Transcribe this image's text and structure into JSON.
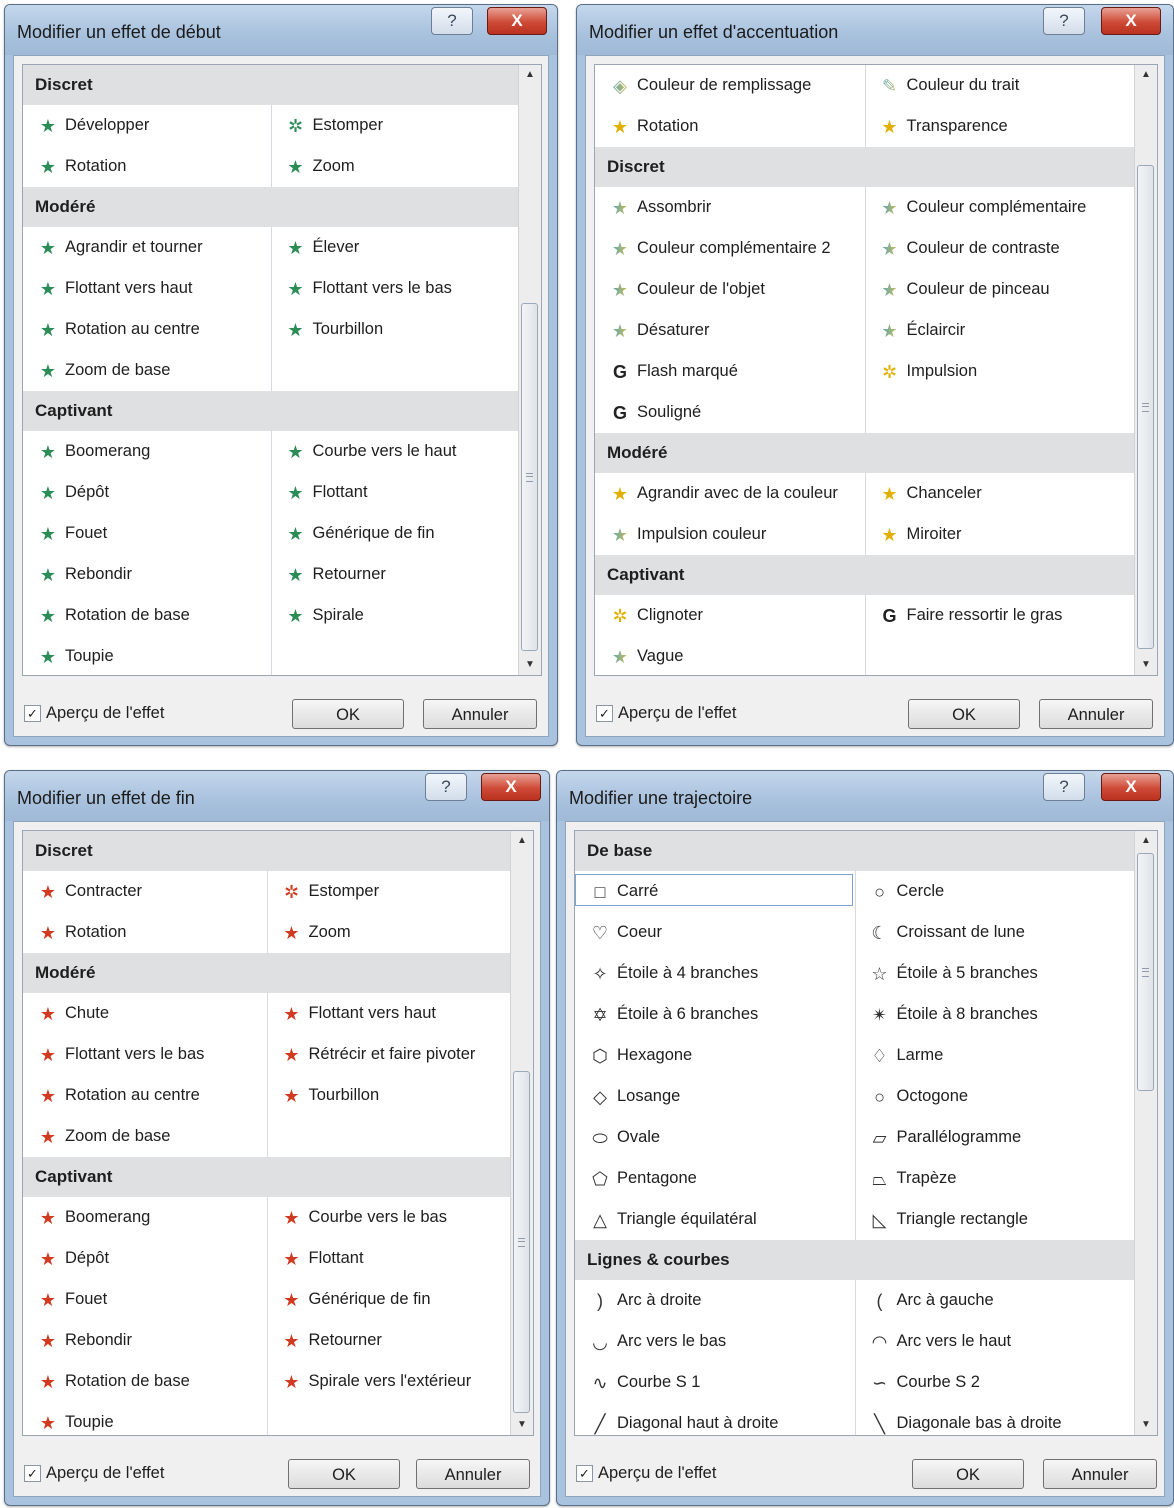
{
  "dialogs": [
    {
      "title": "Modifier un effet de début",
      "help_glyph": "?",
      "close_glyph": "X",
      "preview_label": "Aperçu de l'effet",
      "preview_checked": true,
      "check_glyph": "✓",
      "ok_label": "OK",
      "cancel_label": "Annuler",
      "scroll_up_glyph": "▲",
      "scroll_down_glyph": "▼",
      "sections": [
        {
          "title": "Discret",
          "items": [
            {
              "label": "Développer",
              "icon": "★",
              "color": "g"
            },
            {
              "label": "Estomper",
              "icon": "✲",
              "color": "g"
            },
            {
              "label": "Rotation",
              "icon": "★",
              "color": "g"
            },
            {
              "label": "Zoom",
              "icon": "★",
              "color": "g"
            }
          ]
        },
        {
          "title": "Modéré",
          "items": [
            {
              "label": "Agrandir et tourner",
              "icon": "★",
              "color": "g"
            },
            {
              "label": "Élever",
              "icon": "★",
              "color": "g"
            },
            {
              "label": "Flottant vers haut",
              "icon": "★",
              "color": "g"
            },
            {
              "label": "Flottant vers le bas",
              "icon": "★",
              "color": "g"
            },
            {
              "label": "Rotation au centre",
              "icon": "★",
              "color": "g"
            },
            {
              "label": "Tourbillon",
              "icon": "★",
              "color": "g"
            },
            {
              "label": "Zoom de base",
              "icon": "★",
              "color": "g"
            }
          ]
        },
        {
          "title": "Captivant",
          "items": [
            {
              "label": "Boomerang",
              "icon": "★",
              "color": "g"
            },
            {
              "label": "Courbe vers le haut",
              "icon": "★",
              "color": "g"
            },
            {
              "label": "Dépôt",
              "icon": "★",
              "color": "g"
            },
            {
              "label": "Flottant",
              "icon": "★",
              "color": "g"
            },
            {
              "label": "Fouet",
              "icon": "★",
              "color": "g"
            },
            {
              "label": "Générique de fin",
              "icon": "★",
              "color": "g"
            },
            {
              "label": "Rebondir",
              "icon": "★",
              "color": "g"
            },
            {
              "label": "Retourner",
              "icon": "★",
              "color": "g"
            },
            {
              "label": "Rotation de base",
              "icon": "★",
              "color": "g"
            },
            {
              "label": "Spirale",
              "icon": "★",
              "color": "g"
            },
            {
              "label": "Toupie",
              "icon": "★",
              "color": "g"
            }
          ]
        }
      ]
    },
    {
      "title": "Modifier un effet d'accentuation",
      "help_glyph": "?",
      "close_glyph": "X",
      "preview_label": "Aperçu de l'effet",
      "preview_checked": true,
      "check_glyph": "✓",
      "ok_label": "OK",
      "cancel_label": "Annuler",
      "scroll_up_glyph": "▲",
      "scroll_down_glyph": "▼",
      "sections": [
        {
          "title": "",
          "items": [
            {
              "label": "Couleur de remplissage",
              "icon": "◈",
              "color": "mix"
            },
            {
              "label": "Couleur du trait",
              "icon": "✎",
              "color": "mix"
            },
            {
              "label": "Rotation",
              "icon": "★",
              "color": "y"
            },
            {
              "label": "Transparence",
              "icon": "★",
              "color": "y"
            }
          ]
        },
        {
          "title": "Discret",
          "items": [
            {
              "label": "Assombrir",
              "icon": "★",
              "color": "mix"
            },
            {
              "label": "Couleur complémentaire",
              "icon": "★",
              "color": "mix"
            },
            {
              "label": "Couleur complémentaire 2",
              "icon": "★",
              "color": "mix"
            },
            {
              "label": "Couleur de contraste",
              "icon": "★",
              "color": "mix"
            },
            {
              "label": "Couleur de l'objet",
              "icon": "★",
              "color": "mix"
            },
            {
              "label": "Couleur de pinceau",
              "icon": "★",
              "color": "mix"
            },
            {
              "label": "Désaturer",
              "icon": "★",
              "color": "mix"
            },
            {
              "label": "Éclaircir",
              "icon": "★",
              "color": "mix"
            },
            {
              "label": "Flash marqué",
              "icon": "G",
              "color": "b"
            },
            {
              "label": "Impulsion",
              "icon": "✲",
              "color": "y"
            },
            {
              "label": "Souligné",
              "icon": "G",
              "color": "b"
            }
          ]
        },
        {
          "title": "Modéré",
          "items": [
            {
              "label": "Agrandir avec de la couleur",
              "icon": "★",
              "color": "y"
            },
            {
              "label": "Chanceler",
              "icon": "★",
              "color": "y"
            },
            {
              "label": "Impulsion couleur",
              "icon": "★",
              "color": "mix"
            },
            {
              "label": "Miroiter",
              "icon": "★",
              "color": "y"
            }
          ]
        },
        {
          "title": "Captivant",
          "items": [
            {
              "label": "Clignoter",
              "icon": "✲",
              "color": "y"
            },
            {
              "label": "Faire ressortir le gras",
              "icon": "G",
              "color": "b"
            },
            {
              "label": "Vague",
              "icon": "★",
              "color": "mix"
            }
          ]
        }
      ]
    },
    {
      "title": "Modifier un effet de fin",
      "help_glyph": "?",
      "close_glyph": "X",
      "preview_label": "Aperçu de l'effet",
      "preview_checked": true,
      "check_glyph": "✓",
      "ok_label": "OK",
      "cancel_label": "Annuler",
      "scroll_up_glyph": "▲",
      "scroll_down_glyph": "▼",
      "sections": [
        {
          "title": "Discret",
          "items": [
            {
              "label": "Contracter",
              "icon": "★",
              "color": "r"
            },
            {
              "label": "Estomper",
              "icon": "✲",
              "color": "r"
            },
            {
              "label": "Rotation",
              "icon": "★",
              "color": "r"
            },
            {
              "label": "Zoom",
              "icon": "★",
              "color": "r"
            }
          ]
        },
        {
          "title": "Modéré",
          "items": [
            {
              "label": "Chute",
              "icon": "★",
              "color": "r"
            },
            {
              "label": "Flottant vers haut",
              "icon": "★",
              "color": "r"
            },
            {
              "label": "Flottant vers le bas",
              "icon": "★",
              "color": "r"
            },
            {
              "label": "Rétrécir et faire pivoter",
              "icon": "★",
              "color": "r"
            },
            {
              "label": "Rotation au centre",
              "icon": "★",
              "color": "r"
            },
            {
              "label": "Tourbillon",
              "icon": "★",
              "color": "r"
            },
            {
              "label": "Zoom de base",
              "icon": "★",
              "color": "r"
            }
          ]
        },
        {
          "title": "Captivant",
          "items": [
            {
              "label": "Boomerang",
              "icon": "★",
              "color": "r"
            },
            {
              "label": "Courbe vers le bas",
              "icon": "★",
              "color": "r"
            },
            {
              "label": "Dépôt",
              "icon": "★",
              "color": "r"
            },
            {
              "label": "Flottant",
              "icon": "★",
              "color": "r"
            },
            {
              "label": "Fouet",
              "icon": "★",
              "color": "r"
            },
            {
              "label": "Générique de fin",
              "icon": "★",
              "color": "r"
            },
            {
              "label": "Rebondir",
              "icon": "★",
              "color": "r"
            },
            {
              "label": "Retourner",
              "icon": "★",
              "color": "r"
            },
            {
              "label": "Rotation de base",
              "icon": "★",
              "color": "r"
            },
            {
              "label": "Spirale vers l'extérieur",
              "icon": "★",
              "color": "r"
            },
            {
              "label": "Toupie",
              "icon": "★",
              "color": "r"
            }
          ]
        }
      ]
    },
    {
      "title": "Modifier une trajectoire",
      "help_glyph": "?",
      "close_glyph": "X",
      "preview_label": "Aperçu de l'effet",
      "preview_checked": true,
      "check_glyph": "✓",
      "ok_label": "OK",
      "cancel_label": "Annuler",
      "scroll_up_glyph": "▲",
      "scroll_down_glyph": "▼",
      "sections": [
        {
          "title": "De base",
          "items": [
            {
              "label": "Carré",
              "icon": "□",
              "color": "k",
              "selected": true
            },
            {
              "label": "Cercle",
              "icon": "○",
              "color": "k"
            },
            {
              "label": "Coeur",
              "icon": "♡",
              "color": "k"
            },
            {
              "label": "Croissant de lune",
              "icon": "☾",
              "color": "k"
            },
            {
              "label": "Étoile à 4 branches",
              "icon": "✧",
              "color": "k"
            },
            {
              "label": "Étoile à 5 branches",
              "icon": "☆",
              "color": "k"
            },
            {
              "label": "Étoile à 6 branches",
              "icon": "✡",
              "color": "k"
            },
            {
              "label": "Étoile à 8 branches",
              "icon": "✴",
              "color": "k"
            },
            {
              "label": "Hexagone",
              "icon": "⬡",
              "color": "k"
            },
            {
              "label": "Larme",
              "icon": "♢",
              "color": "k"
            },
            {
              "label": "Losange",
              "icon": "◇",
              "color": "k"
            },
            {
              "label": "Octogone",
              "icon": "○",
              "color": "k"
            },
            {
              "label": "Ovale",
              "icon": "⬭",
              "color": "k"
            },
            {
              "label": "Parallélogramme",
              "icon": "▱",
              "color": "k"
            },
            {
              "label": "Pentagone",
              "icon": "⬠",
              "color": "k"
            },
            {
              "label": "Trapèze",
              "icon": "⏢",
              "color": "k"
            },
            {
              "label": "Triangle équilatéral",
              "icon": "△",
              "color": "k"
            },
            {
              "label": "Triangle rectangle",
              "icon": "◺",
              "color": "k"
            }
          ]
        },
        {
          "title": "Lignes & courbes",
          "items": [
            {
              "label": "Arc à droite",
              "icon": ")",
              "color": "k"
            },
            {
              "label": "Arc à gauche",
              "icon": "(",
              "color": "k"
            },
            {
              "label": "Arc vers le bas",
              "icon": "◡",
              "color": "k"
            },
            {
              "label": "Arc vers le haut",
              "icon": "◠",
              "color": "k"
            },
            {
              "label": "Courbe S 1",
              "icon": "∿",
              "color": "k"
            },
            {
              "label": "Courbe S 2",
              "icon": "∽",
              "color": "k"
            },
            {
              "label": "Diagonal haut à droite",
              "icon": "╱",
              "color": "k"
            },
            {
              "label": "Diagonale bas à droite",
              "icon": "╲",
              "color": "k"
            }
          ]
        }
      ]
    }
  ]
}
